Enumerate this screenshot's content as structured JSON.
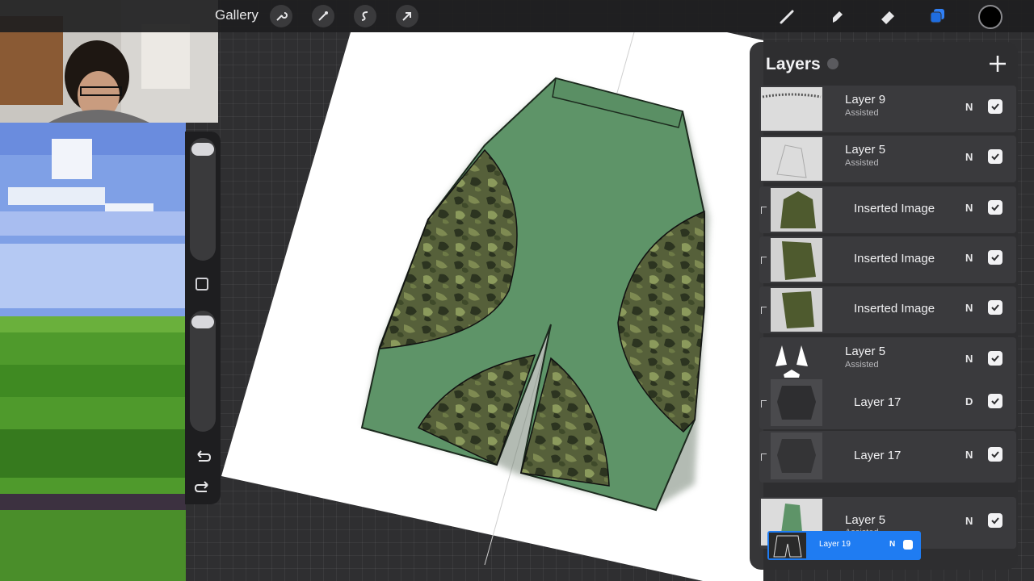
{
  "topbar": {
    "gallery_label": "Gallery",
    "tools": [
      "wrench-icon",
      "magic-wand-icon",
      "selection-icon",
      "transform-arrow-icon"
    ],
    "right_tools": [
      "brush-icon",
      "smudge-icon",
      "eraser-icon",
      "layers-icon"
    ],
    "active_color": "#000000"
  },
  "layers_panel": {
    "title": "Layers",
    "rows": [
      {
        "name": "Layer 9",
        "sub": "Assisted",
        "blend": "N",
        "visible": true,
        "clipped": false
      },
      {
        "name": "Layer 5",
        "sub": "Assisted",
        "blend": "N",
        "visible": true,
        "clipped": false
      },
      {
        "name": "Inserted Image",
        "sub": "",
        "blend": "N",
        "visible": true,
        "clipped": true
      },
      {
        "name": "Inserted Image",
        "sub": "",
        "blend": "N",
        "visible": true,
        "clipped": true
      },
      {
        "name": "Inserted Image",
        "sub": "",
        "blend": "N",
        "visible": true,
        "clipped": true
      },
      {
        "name": "Layer 5",
        "sub": "Assisted",
        "blend": "N",
        "visible": true,
        "clipped": false
      },
      {
        "name": "Layer 17",
        "sub": "",
        "blend": "D",
        "visible": true,
        "clipped": true
      },
      {
        "name": "Layer 17",
        "sub": "",
        "blend": "N",
        "visible": true,
        "clipped": true
      },
      {
        "name": "Layer 5",
        "sub": "Assisted",
        "blend": "N",
        "visible": true,
        "clipped": false
      }
    ],
    "dragging_layer": {
      "name": "Layer 19",
      "blend": "N"
    },
    "accent_color": "#1f7cf2"
  },
  "colors": {
    "pants_green": "#5e9468",
    "camo_dark": "#3a4626",
    "sky": "#7fa0e6",
    "grass": "#4f9a2c"
  }
}
